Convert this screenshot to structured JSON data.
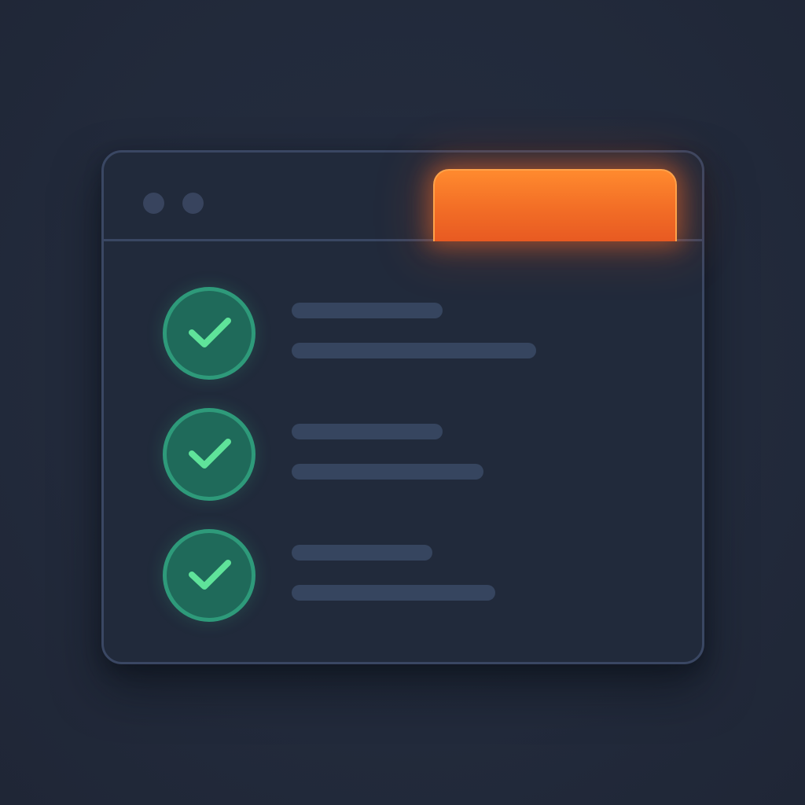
{
  "window": {
    "accent_color": "#f26d26",
    "border_color": "#3a4763",
    "background_color": "#212a3b"
  },
  "titlebar": {
    "controls": [
      "window-dot-icon",
      "window-dot-icon"
    ],
    "active_tab": {
      "label": "",
      "color": "#f26d26",
      "state": "highlighted"
    }
  },
  "checklist": {
    "check_color": "#5fe39a",
    "circle_color": "#1f6a5a",
    "bar_color": "#36455f",
    "items": [
      {
        "icon": "check-circle-icon",
        "status": "completed",
        "title": "",
        "subtitle": ""
      },
      {
        "icon": "check-circle-icon",
        "status": "completed",
        "title": "",
        "subtitle": ""
      },
      {
        "icon": "check-circle-icon",
        "status": "completed",
        "title": "",
        "subtitle": ""
      }
    ]
  }
}
